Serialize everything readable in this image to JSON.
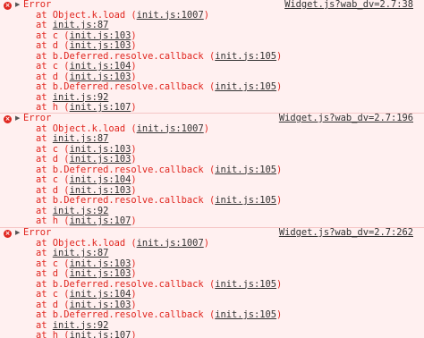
{
  "console": {
    "entries": [
      {
        "icon": "error-icon",
        "message": "Error",
        "source": "Widget.js?wab_dv=2.7:38",
        "frames": [
          {
            "at": "at ",
            "fn": "Object.k.load",
            "loc": "init.js:1007"
          },
          {
            "at": "at ",
            "fn": "",
            "loc": "init.js:87"
          },
          {
            "at": "at ",
            "fn": "c",
            "loc": "init.js:103"
          },
          {
            "at": "at ",
            "fn": "d",
            "loc": "init.js:103"
          },
          {
            "at": "at ",
            "fn": "b.Deferred.resolve.callback",
            "loc": "init.js:105"
          },
          {
            "at": "at ",
            "fn": "c",
            "loc": "init.js:104"
          },
          {
            "at": "at ",
            "fn": "d",
            "loc": "init.js:103"
          },
          {
            "at": "at ",
            "fn": "b.Deferred.resolve.callback",
            "loc": "init.js:105"
          },
          {
            "at": "at ",
            "fn": "",
            "loc": "init.js:92"
          },
          {
            "at": "at ",
            "fn": "h",
            "loc": "init.js:107"
          }
        ]
      },
      {
        "icon": "error-icon",
        "message": "Error",
        "source": "Widget.js?wab_dv=2.7:196",
        "frames": [
          {
            "at": "at ",
            "fn": "Object.k.load",
            "loc": "init.js:1007"
          },
          {
            "at": "at ",
            "fn": "",
            "loc": "init.js:87"
          },
          {
            "at": "at ",
            "fn": "c",
            "loc": "init.js:103"
          },
          {
            "at": "at ",
            "fn": "d",
            "loc": "init.js:103"
          },
          {
            "at": "at ",
            "fn": "b.Deferred.resolve.callback",
            "loc": "init.js:105"
          },
          {
            "at": "at ",
            "fn": "c",
            "loc": "init.js:104"
          },
          {
            "at": "at ",
            "fn": "d",
            "loc": "init.js:103"
          },
          {
            "at": "at ",
            "fn": "b.Deferred.resolve.callback",
            "loc": "init.js:105"
          },
          {
            "at": "at ",
            "fn": "",
            "loc": "init.js:92"
          },
          {
            "at": "at ",
            "fn": "h",
            "loc": "init.js:107"
          }
        ]
      },
      {
        "icon": "error-icon",
        "message": "Error",
        "source": "Widget.js?wab_dv=2.7:262",
        "frames": [
          {
            "at": "at ",
            "fn": "Object.k.load",
            "loc": "init.js:1007"
          },
          {
            "at": "at ",
            "fn": "",
            "loc": "init.js:87"
          },
          {
            "at": "at ",
            "fn": "c",
            "loc": "init.js:103"
          },
          {
            "at": "at ",
            "fn": "d",
            "loc": "init.js:103"
          },
          {
            "at": "at ",
            "fn": "b.Deferred.resolve.callback",
            "loc": "init.js:105"
          },
          {
            "at": "at ",
            "fn": "c",
            "loc": "init.js:104"
          },
          {
            "at": "at ",
            "fn": "d",
            "loc": "init.js:103"
          },
          {
            "at": "at ",
            "fn": "b.Deferred.resolve.callback",
            "loc": "init.js:105"
          },
          {
            "at": "at ",
            "fn": "",
            "loc": "init.js:92"
          },
          {
            "at": "at ",
            "fn": "h",
            "loc": "init.js:107"
          }
        ]
      }
    ],
    "colors": {
      "error_text": "#e0261f",
      "link_text": "#333333",
      "background": "#fff0f0",
      "divider": "#f5c6c6"
    }
  }
}
